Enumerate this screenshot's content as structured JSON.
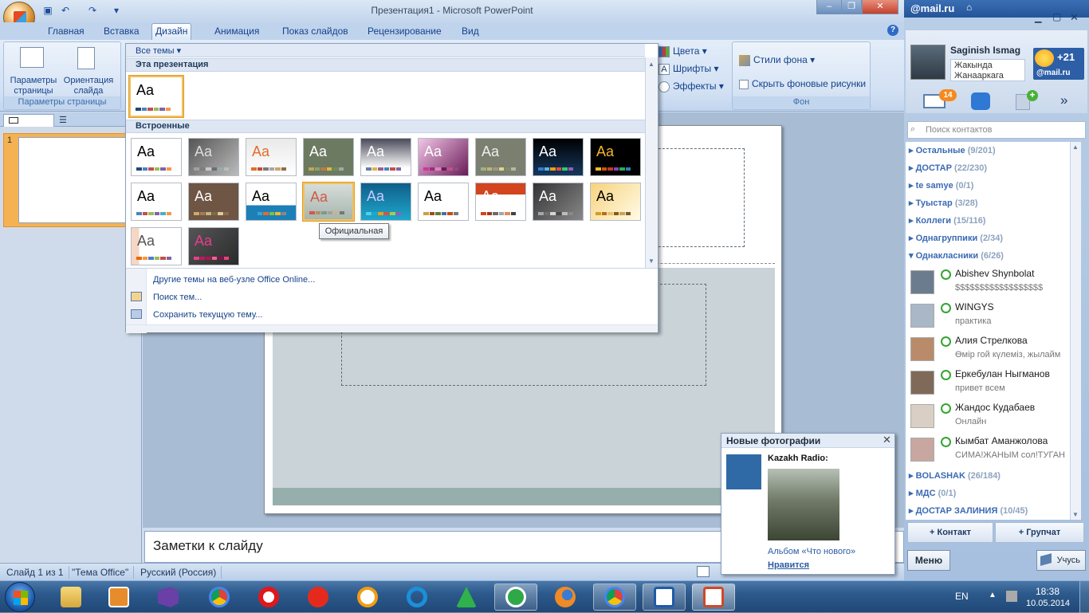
{
  "window": {
    "title": "Презентация1 - Microsoft PowerPoint"
  },
  "ribbon": {
    "tabs": [
      "Главная",
      "Вставка",
      "Дизайн",
      "Анимация",
      "Показ слайдов",
      "Рецензирование",
      "Вид"
    ],
    "active_tab": "Дизайн",
    "page_setup": {
      "btn1": "Параметры страницы",
      "btn2": "Ориентация слайда",
      "group_label": "Параметры страницы"
    },
    "theme_options": {
      "colors": "Цвета",
      "fonts": "Шрифты",
      "effects": "Эффекты"
    },
    "background": {
      "styles": "Стили фона",
      "hide": "Скрыть фоновые рисунки",
      "group_label": "Фон"
    }
  },
  "themes_gallery": {
    "filter": "Все темы",
    "section_this": "Эта презентация",
    "section_builtin": "Встроенные",
    "tooltip": "Официальная",
    "menu": [
      "Другие темы на веб-узле Office Online...",
      "Поиск тем...",
      "Сохранить текущую тему..."
    ],
    "aa_label": "Aa"
  },
  "slides_pane": {
    "slide_number": "1"
  },
  "notes": {
    "placeholder": "Заметки к слайду"
  },
  "status": {
    "slide": "Слайд 1 из 1",
    "theme": "\"Тема Office\"",
    "language": "Русский (Россия)"
  },
  "agent": {
    "brand": "@mail.ru",
    "user_name": "Saginish Ismag",
    "user_status": "Жакында Жанааркага",
    "weather": "+21",
    "weather_brand": "@mail.ru",
    "mail_badge": "14",
    "search_placeholder": "Поиск контактов",
    "groups_top": [
      {
        "name": "Остальные",
        "count": "(9/201)"
      },
      {
        "name": "ДОСТАР",
        "count": "(22/230)"
      },
      {
        "name": "te samye",
        "count": "(0/1)"
      },
      {
        "name": "Туыстар",
        "count": "(3/28)"
      },
      {
        "name": "Коллеги",
        "count": "(15/116)"
      },
      {
        "name": "Однагруппики",
        "count": "(2/34)"
      },
      {
        "name": "Однакласники",
        "count": "(6/26)"
      }
    ],
    "contacts": [
      {
        "name": "Abishev Shynbolat",
        "status": "$$$$$$$$$$$$$$$$$$"
      },
      {
        "name": "WINGYS",
        "status": "практика"
      },
      {
        "name": "Алия Стрелкова",
        "status": "Өмір гой күлеміз, жылайм"
      },
      {
        "name": "Еркебулан Ныгманов",
        "status": "привет всем"
      },
      {
        "name": "Жандос Кудабаев",
        "status": "Онлайн"
      },
      {
        "name": "Кымбат Аманжолова",
        "status": "СИМА!ЖАНЫМ сол!ТУГАН"
      }
    ],
    "groups_bottom": [
      {
        "name": "BOLASHAK",
        "count": "(26/184)"
      },
      {
        "name": "МДС",
        "count": "(0/1)"
      },
      {
        "name": "ДОСТАР ЗАЛИНИЯ",
        "count": "(10/45)"
      }
    ],
    "add_contact": "+ Контакт",
    "add_group": "+ Групчат",
    "menu": "Меню",
    "learn": "Учусь"
  },
  "popup": {
    "title": "Новые фотографии",
    "source": "Kazakh Radio:",
    "album": "Альбом «Что нового»",
    "like": "Нравится"
  },
  "taskbar": {
    "lang": "EN",
    "time": "18:38",
    "date": "10.05.2014"
  }
}
